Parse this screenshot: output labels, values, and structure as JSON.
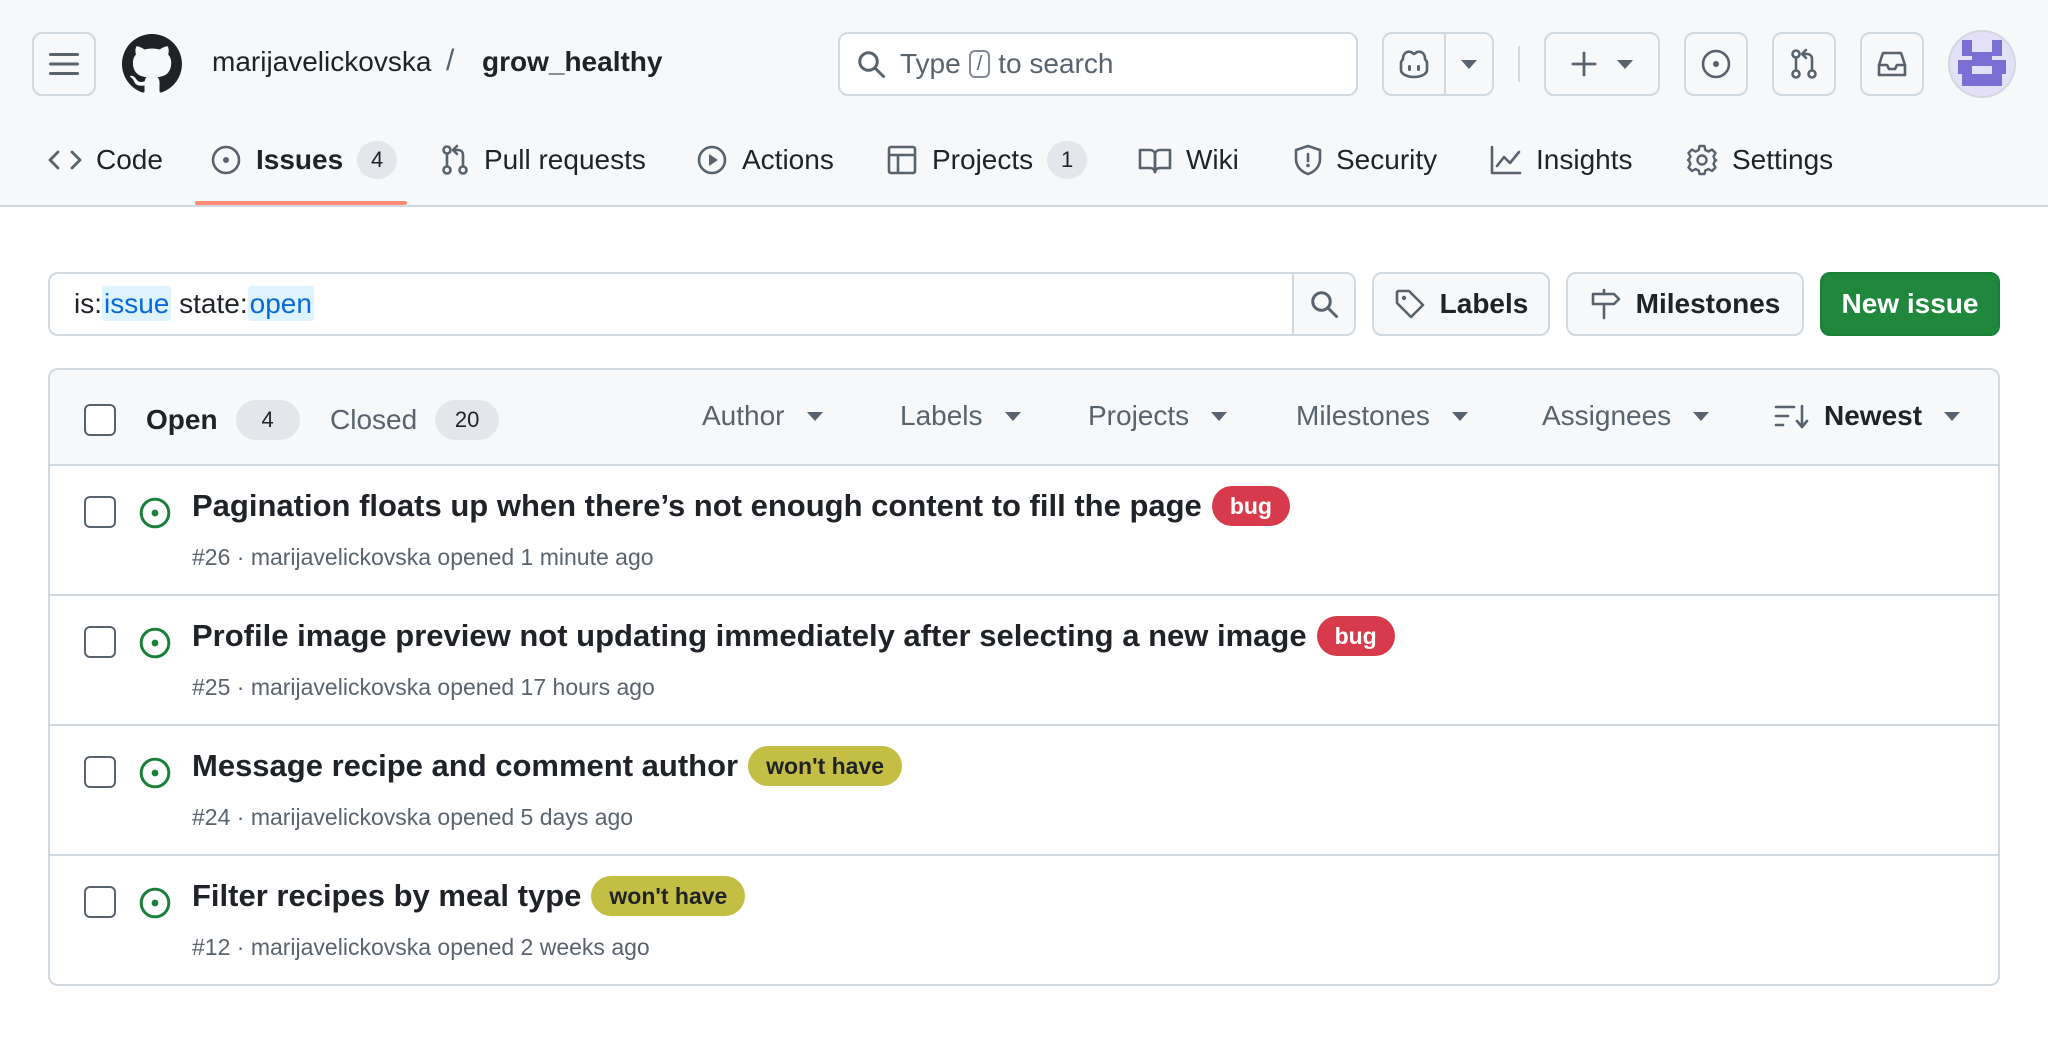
{
  "header": {
    "owner": "marijavelickovska",
    "separator": "/",
    "repo": "grow_healthy",
    "search": {
      "prefix": "Type",
      "key": "/",
      "suffix": "to search"
    }
  },
  "tabs": [
    {
      "label": "Code",
      "icon": "code-icon"
    },
    {
      "label": "Issues",
      "icon": "issue-opened-icon",
      "count": "4"
    },
    {
      "label": "Pull requests",
      "icon": "git-pull-request-icon"
    },
    {
      "label": "Actions",
      "icon": "play-icon"
    },
    {
      "label": "Projects",
      "icon": "table-icon",
      "count": "1"
    },
    {
      "label": "Wiki",
      "icon": "book-icon"
    },
    {
      "label": "Security",
      "icon": "shield-icon"
    },
    {
      "label": "Insights",
      "icon": "graph-icon"
    },
    {
      "label": "Settings",
      "icon": "gear-icon"
    }
  ],
  "filter": {
    "parts": [
      "is:",
      "issue",
      " state:",
      "open"
    ],
    "labels_button": "Labels",
    "milestones_button": "Milestones",
    "new_issue_button": "New issue"
  },
  "list_header": {
    "open_label": "Open",
    "open_count": "4",
    "closed_label": "Closed",
    "closed_count": "20",
    "filters": [
      "Author",
      "Labels",
      "Projects",
      "Milestones",
      "Assignees"
    ],
    "sort_label": "Newest"
  },
  "colors": {
    "accent_green": "#1f883d",
    "open_icon_green": "#1a7f37",
    "bug_label": "#d73a4a",
    "wont_have_label": "#c5be45",
    "tab_underline": "#fd8c73"
  },
  "issues": [
    {
      "title": "Pagination floats up when there’s not enough content to fill the page",
      "label": "bug",
      "label_color": "#d73a4a",
      "label_text_color": "#ffffff",
      "meta": "#26 · marijavelickovska opened 1 minute ago"
    },
    {
      "title": "Profile image preview not updating immediately after selecting a new image",
      "label": "bug",
      "label_color": "#d73a4a",
      "label_text_color": "#ffffff",
      "meta": "#25 · marijavelickovska opened 17 hours ago"
    },
    {
      "title": "Message recipe and comment author",
      "label": "won't have",
      "label_color": "#c5be45",
      "label_text_color": "#1f2328",
      "meta": "#24 · marijavelickovska opened 5 days ago"
    },
    {
      "title": "Filter recipes by meal type",
      "label": "won't have",
      "label_color": "#c5be45",
      "label_text_color": "#1f2328",
      "meta": "#12 · marijavelickovska opened 2 weeks ago"
    }
  ]
}
